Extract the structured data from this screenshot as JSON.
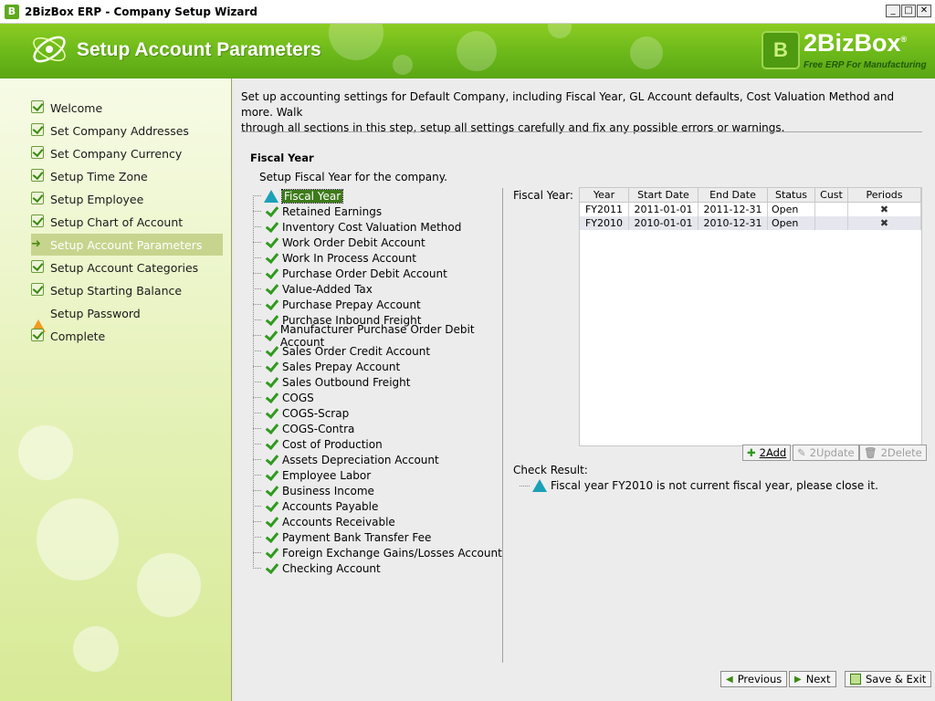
{
  "window": {
    "logo_letter": "B",
    "title": "2BizBox ERP - Company Setup Wizard",
    "controls": {
      "minimize": "_",
      "maximize": "□",
      "close": "✕"
    }
  },
  "banner": {
    "title": "Setup Account Parameters",
    "brand_letter": "B",
    "brand_name": "2BizBox",
    "brand_registered": "®",
    "brand_tagline": "Free ERP For Manufacturing",
    "color": "#6bb81a"
  },
  "sidebar": {
    "steps": [
      {
        "label": "Welcome",
        "state": "done"
      },
      {
        "label": "Set Company Addresses",
        "state": "done"
      },
      {
        "label": "Set Company Currency",
        "state": "done"
      },
      {
        "label": "Setup Time Zone",
        "state": "done"
      },
      {
        "label": "Setup Employee",
        "state": "done"
      },
      {
        "label": "Setup Chart of Account",
        "state": "done"
      },
      {
        "label": "Setup Account Parameters",
        "state": "current"
      },
      {
        "label": "Setup Account Categories",
        "state": "done"
      },
      {
        "label": "Setup Starting Balance",
        "state": "done"
      },
      {
        "label": "Setup Password",
        "state": "warning"
      },
      {
        "label": "Complete",
        "state": "done"
      }
    ]
  },
  "main": {
    "intro_line1": "Set up accounting settings for Default Company, including Fiscal Year, GL Account defaults, Cost Valuation Method and more. Walk",
    "intro_line2": "through all sections in this step, setup all settings carefully and fix any possible errors or warnings.",
    "section_title": "Fiscal Year",
    "section_desc": "Setup Fiscal Year for the company.",
    "tree": [
      {
        "label": "Fiscal Year",
        "state": "warning",
        "selected": true
      },
      {
        "label": "Retained Earnings",
        "state": "ok"
      },
      {
        "label": "Inventory Cost Valuation Method",
        "state": "ok"
      },
      {
        "label": "Work Order Debit Account",
        "state": "ok"
      },
      {
        "label": "Work In Process Account",
        "state": "ok"
      },
      {
        "label": "Purchase Order Debit Account",
        "state": "ok"
      },
      {
        "label": "Value-Added Tax",
        "state": "ok"
      },
      {
        "label": "Purchase Prepay Account",
        "state": "ok"
      },
      {
        "label": "Purchase Inbound Freight",
        "state": "ok"
      },
      {
        "label": "Manufacturer Purchase Order Debit Account",
        "state": "ok"
      },
      {
        "label": "Sales Order Credit Account",
        "state": "ok"
      },
      {
        "label": "Sales Prepay Account",
        "state": "ok"
      },
      {
        "label": "Sales Outbound Freight",
        "state": "ok"
      },
      {
        "label": "COGS",
        "state": "ok"
      },
      {
        "label": "COGS-Scrap",
        "state": "ok"
      },
      {
        "label": "COGS-Contra",
        "state": "ok"
      },
      {
        "label": "Cost of Production",
        "state": "ok"
      },
      {
        "label": "Assets Depreciation Account",
        "state": "ok"
      },
      {
        "label": "Employee Labor",
        "state": "ok"
      },
      {
        "label": "Business Income",
        "state": "ok"
      },
      {
        "label": "Accounts Payable",
        "state": "ok"
      },
      {
        "label": "Accounts Receivable",
        "state": "ok"
      },
      {
        "label": "Payment Bank Transfer Fee",
        "state": "ok"
      },
      {
        "label": "Foreign Exchange Gains/Losses Account",
        "state": "ok"
      },
      {
        "label": "Checking Account",
        "state": "ok"
      }
    ],
    "fiscal_year_label": "Fiscal Year:",
    "grid": {
      "columns": [
        "Year",
        "Start Date",
        "End Date",
        "Status",
        "Cust",
        "Periods"
      ],
      "rows": [
        {
          "year": "FY2011",
          "start": "2011-01-01",
          "end": "2011-12-31",
          "status": "Open",
          "cust": "",
          "periods": "✖"
        },
        {
          "year": "FY2010",
          "start": "2010-01-01",
          "end": "2010-12-31",
          "status": "Open",
          "cust": "",
          "periods": "✖"
        }
      ]
    },
    "buttons": {
      "add": "2Add",
      "update": "2Update",
      "delete": "2Delete"
    },
    "check_result_label": "Check Result:",
    "check_result_message": "Fiscal year FY2010 is not current fiscal year, please close it."
  },
  "footer": {
    "previous": "Previous",
    "next": "Next",
    "save_exit": "Save & Exit"
  }
}
